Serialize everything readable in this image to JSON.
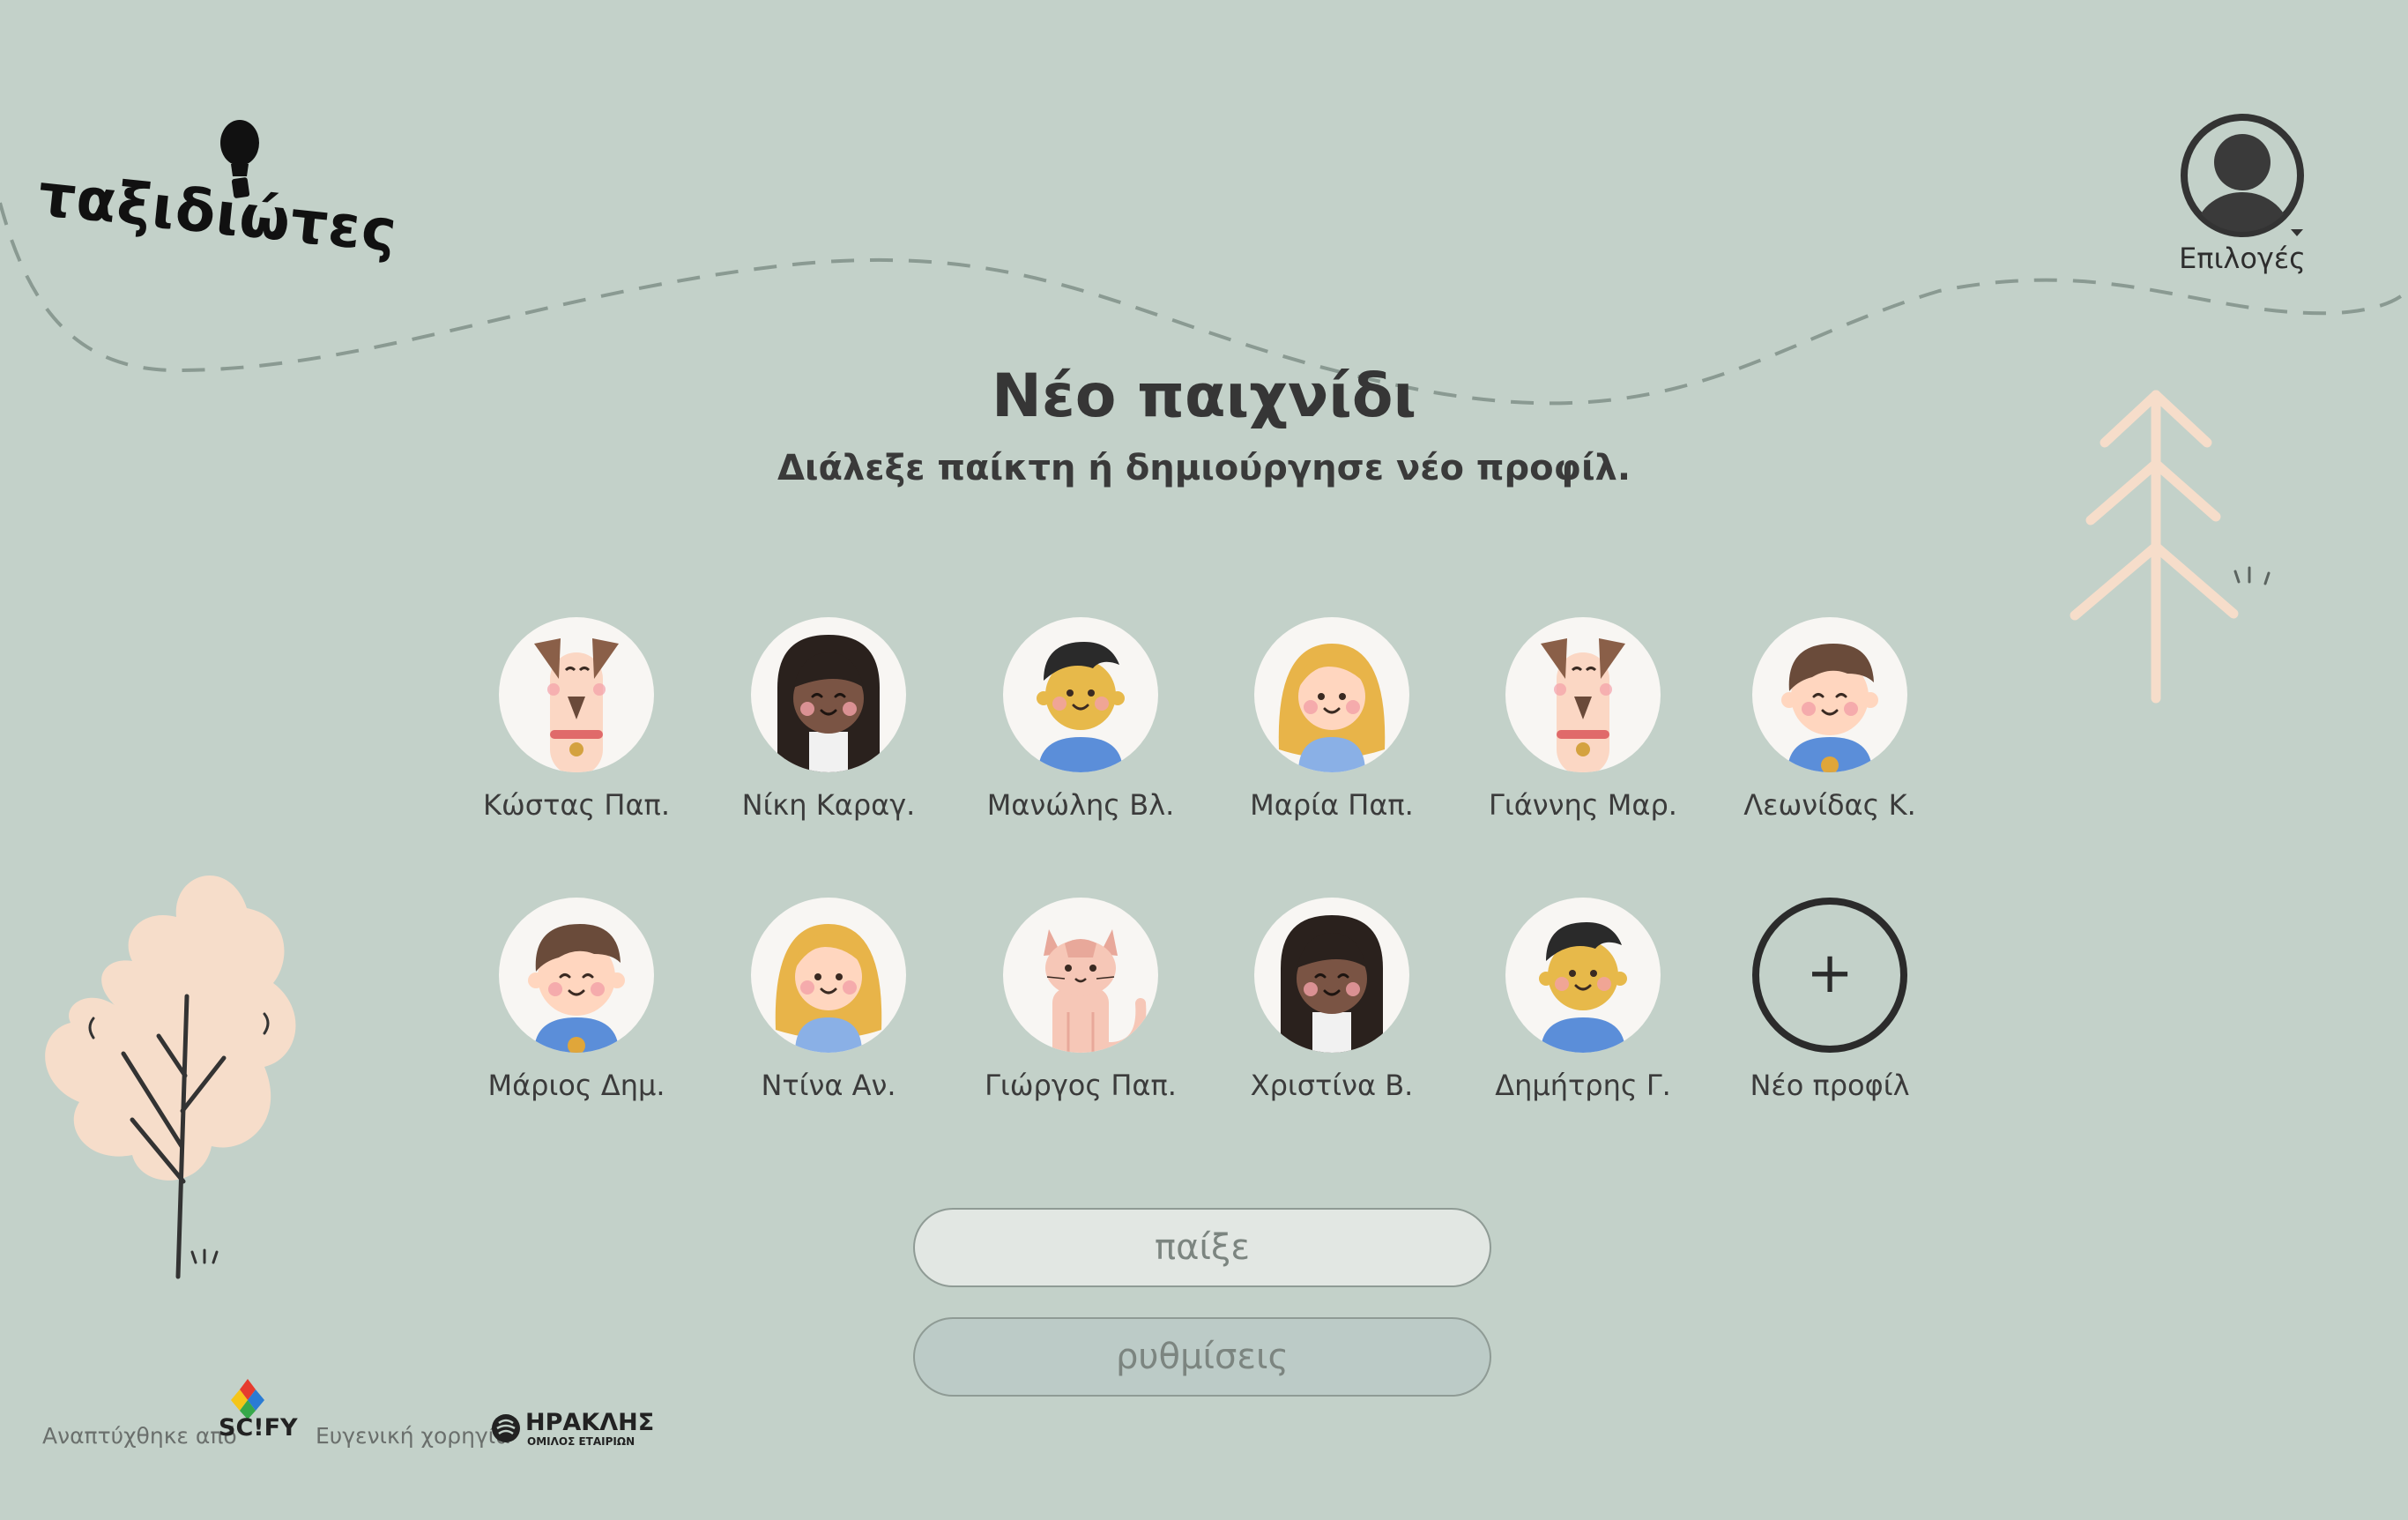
{
  "app": {
    "logo_text": "ταξιδιώτες"
  },
  "header": {
    "options_label": "Επιλογές"
  },
  "main": {
    "title": "Νέο παιχνίδι",
    "subtitle": "Διάλεξε παίκτη ή δημιούργησε νέο προφίλ."
  },
  "profiles": [
    {
      "name": "Κώστας Παπ.",
      "avatar": "dog-icon"
    },
    {
      "name": "Νίκη Καραγ.",
      "avatar": "girl-dark-hair-icon"
    },
    {
      "name": "Μανώλης Βλ.",
      "avatar": "boy-black-hair-icon"
    },
    {
      "name": "Μαρία Παπ.",
      "avatar": "girl-blonde-icon"
    },
    {
      "name": "Γιάννης Μαρ.",
      "avatar": "dog-icon"
    },
    {
      "name": "Λεωνίδας Κ.",
      "avatar": "boy-brown-hair-icon"
    },
    {
      "name": "Μάριος Δημ.",
      "avatar": "boy-brown-hair-icon"
    },
    {
      "name": "Ντίνα Αν.",
      "avatar": "girl-blonde-icon"
    },
    {
      "name": "Γιώργος Παπ.",
      "avatar": "cat-icon"
    },
    {
      "name": "Χριστίνα Β.",
      "avatar": "girl-dark-hair-icon"
    },
    {
      "name": "Δημήτρης Γ.",
      "avatar": "boy-black-hair-icon"
    }
  ],
  "new_profile": {
    "label": "Νέο προφίλ",
    "plus": "+"
  },
  "buttons": {
    "play_label": "παίξε",
    "settings_label": "ρυθμίσεις"
  },
  "footer": {
    "developed_by": "Αναπτύχθηκε από",
    "developer_logo_text": "SC!FY",
    "sponsored_by": "Ευγενική χορηγία",
    "sponsor_logo_text": "ΗΡΑΚΛΗΣ",
    "sponsor_logo_subtext": "ΟΜΙΛΟΣ ΕΤΑΙΡΙΩΝ"
  },
  "colors": {
    "background": "#c3d1c9",
    "tree_light": "#f6ddca",
    "dashed_path": "#8a9a92"
  }
}
